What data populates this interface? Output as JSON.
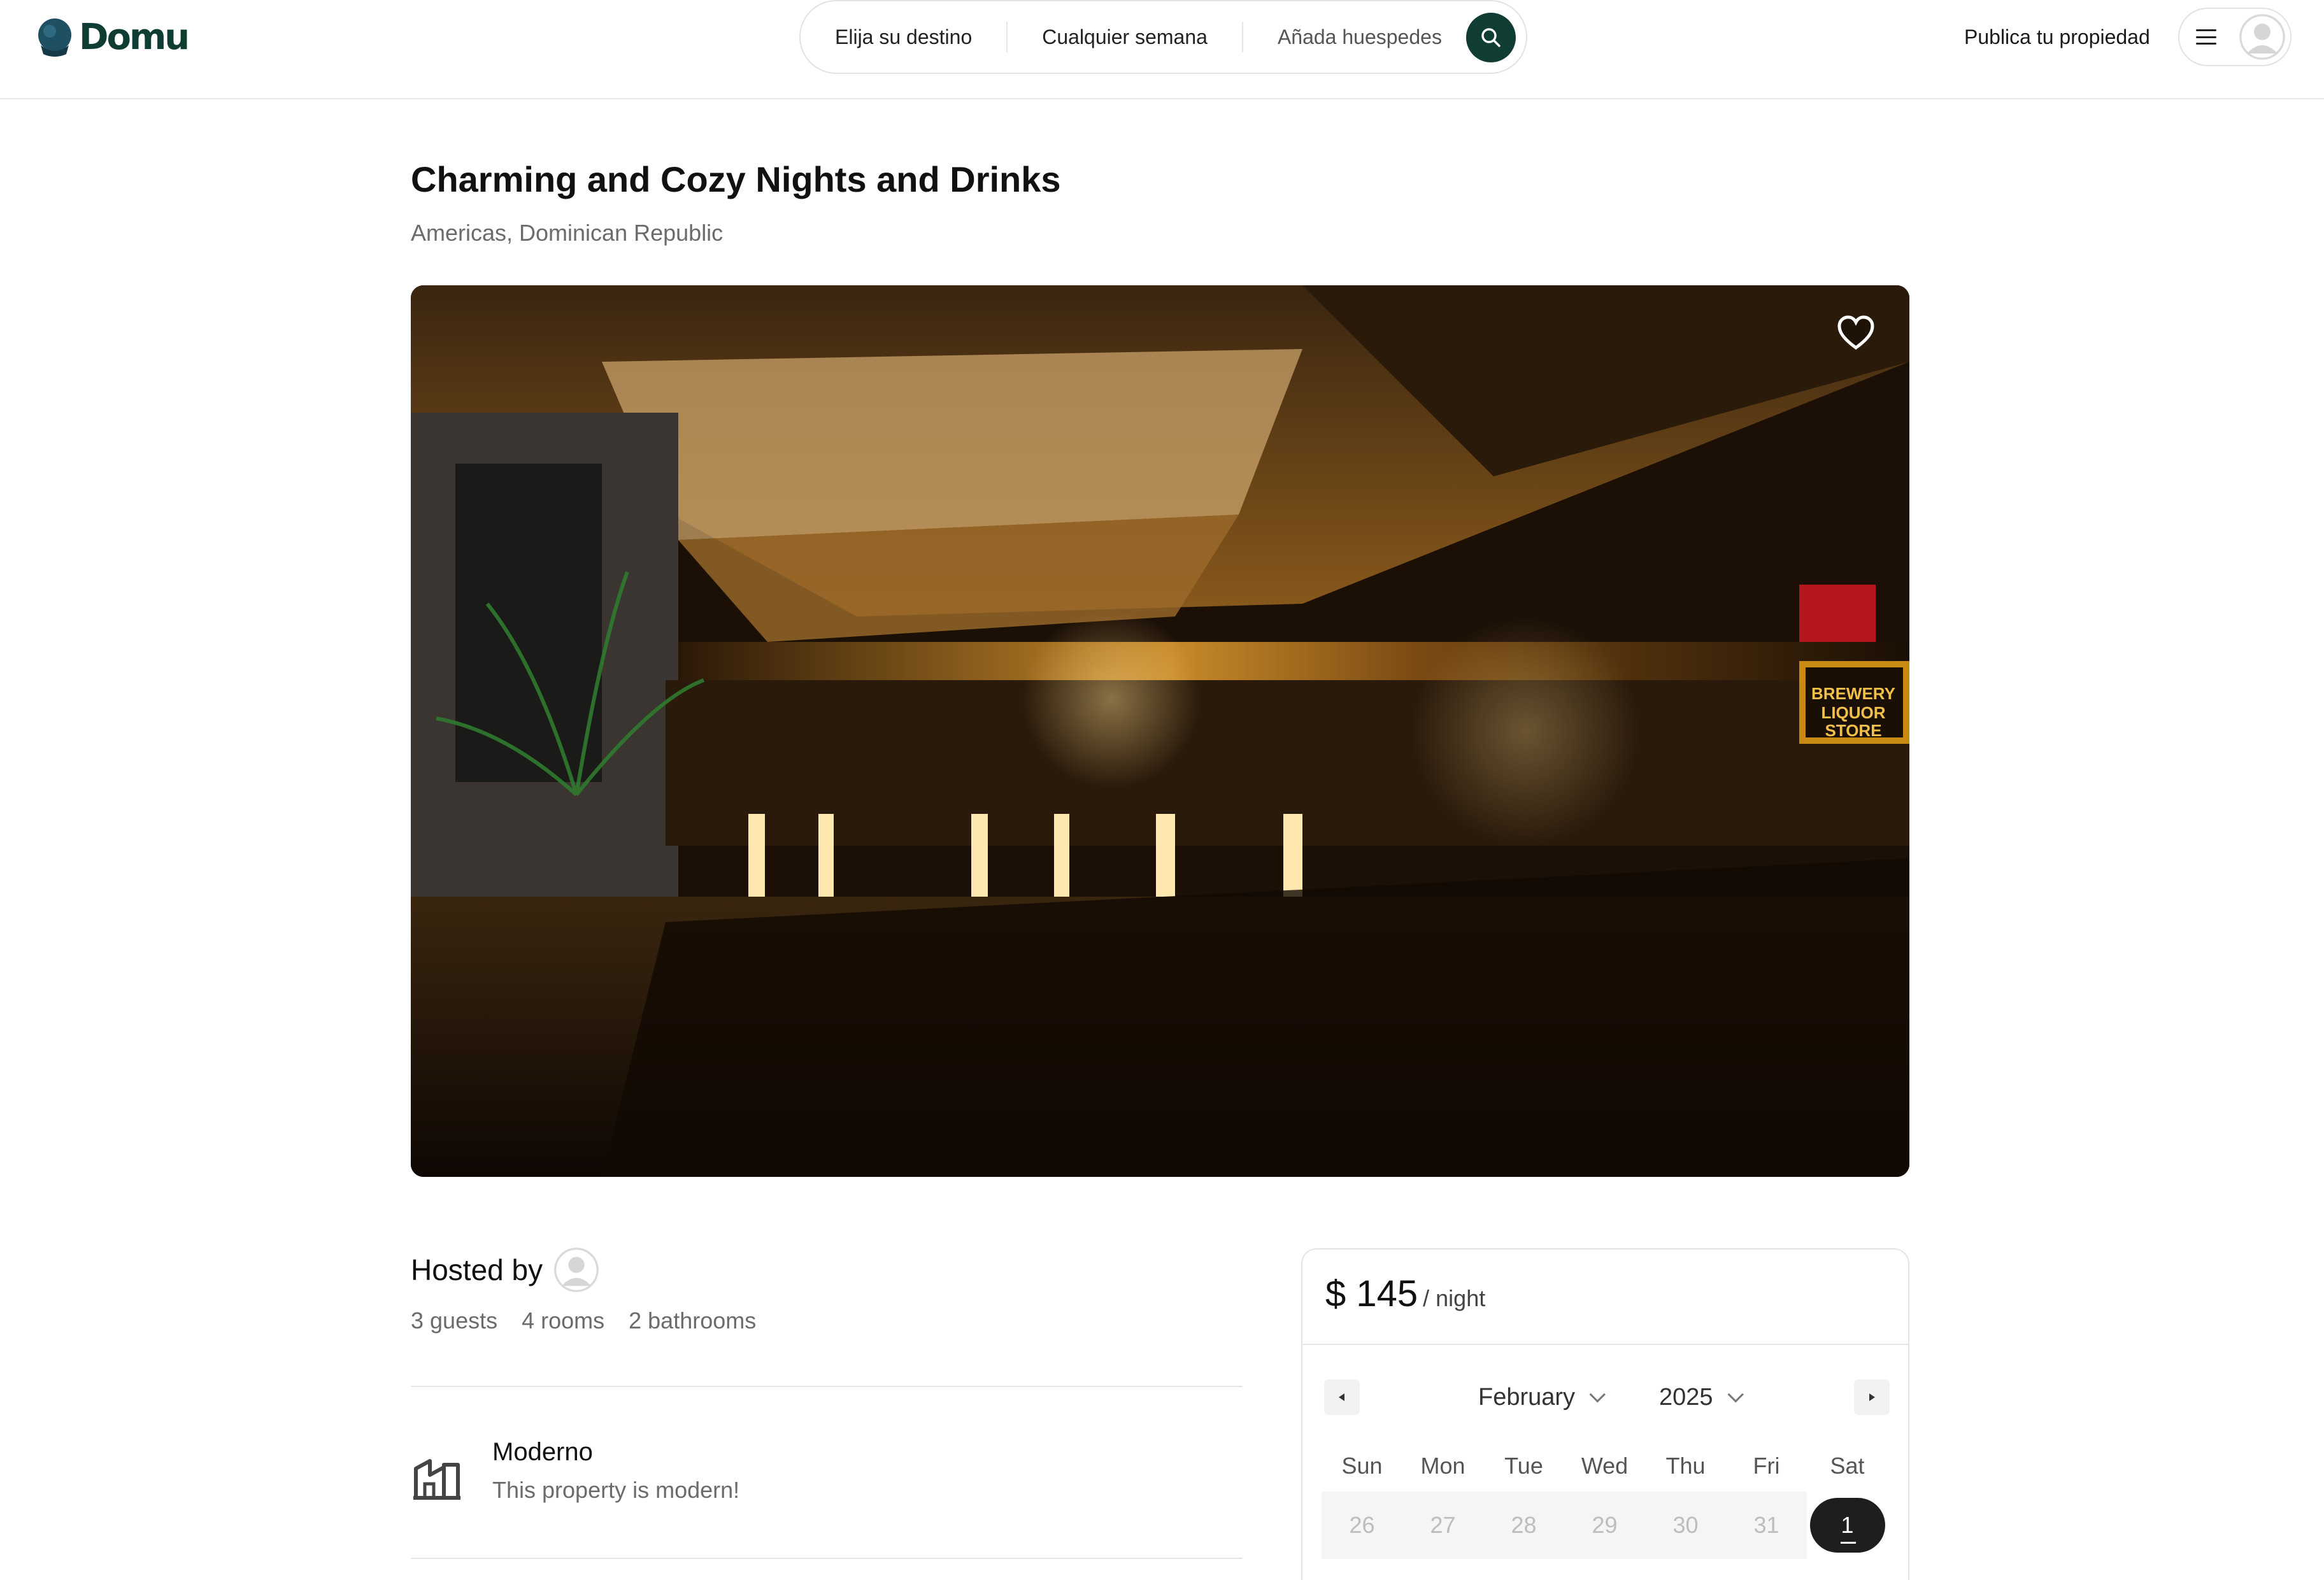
{
  "brand": {
    "name": "Domu",
    "color": "#0f3d33"
  },
  "search": {
    "destination": "Elija su destino",
    "week": "Cualquier semana",
    "guests": "Añada huespedes",
    "icon": "search-icon"
  },
  "header": {
    "publish_label": "Publica tu propiedad",
    "menu_icon": "hamburger-icon",
    "avatar_icon": "user-avatar"
  },
  "listing": {
    "title": "Charming and Cozy Nights and Drinks",
    "location": "Americas, Dominican Republic",
    "favorite_icon": "heart-icon"
  },
  "host": {
    "hosted_by": "Hosted by",
    "guests": "3 guests",
    "rooms": "4 rooms",
    "bathrooms": "2 bathrooms"
  },
  "features": [
    {
      "icon": "building-icon",
      "title": "Moderno",
      "description": "This property is modern!"
    }
  ],
  "booking": {
    "price": "$ 145",
    "per": "/ night",
    "calendar": {
      "month": "February",
      "year": "2025",
      "weekdays": [
        "Sun",
        "Mon",
        "Tue",
        "Wed",
        "Thu",
        "Fri",
        "Sat"
      ],
      "days": [
        "26",
        "27",
        "28",
        "29",
        "30",
        "31",
        "1"
      ],
      "selected_day": "1"
    }
  }
}
